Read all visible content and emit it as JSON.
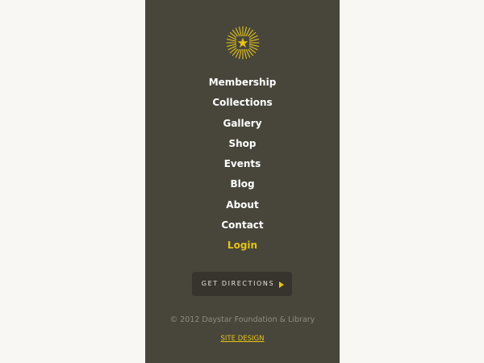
{
  "brand": {
    "logo_icon": "sunburst-star-logo-icon",
    "accent_color": "#e5c318"
  },
  "nav": {
    "items": [
      {
        "label": "Membership"
      },
      {
        "label": "Collections"
      },
      {
        "label": "Gallery"
      },
      {
        "label": "Shop"
      },
      {
        "label": "Events"
      },
      {
        "label": "Blog"
      },
      {
        "label": "About"
      },
      {
        "label": "Contact"
      },
      {
        "label": "Login"
      }
    ]
  },
  "cta": {
    "label": "GET DIRECTIONS",
    "icon": "play-arrow-icon"
  },
  "footer": {
    "copyright": "© 2012 Daystar Foundation & Library",
    "site_design": "SITE DESIGN"
  }
}
